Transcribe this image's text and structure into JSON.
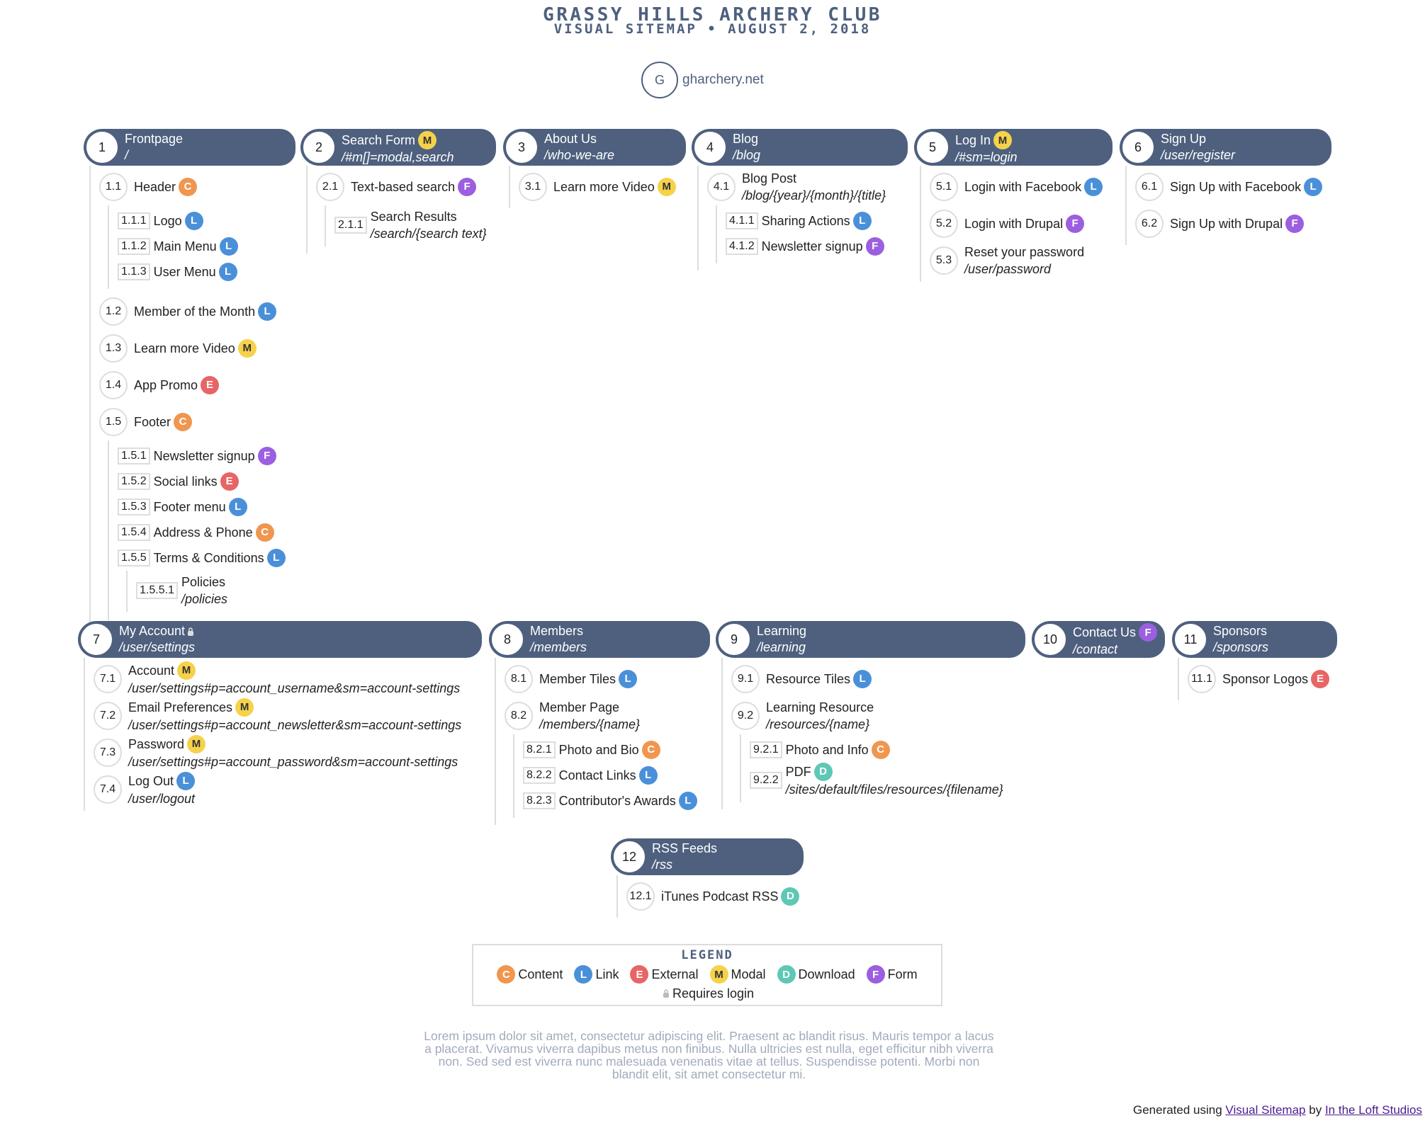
{
  "header": {
    "title": "GRASSY HILLS ARCHERY CLUB",
    "subtitle": "VISUAL SITEMAP • AUGUST 2, 2018"
  },
  "home": {
    "letter": "G",
    "label": "gharchery.net"
  },
  "colors": {
    "header_bg": "#4e607e",
    "C": "#f0964f",
    "L": "#4a90d9",
    "E": "#e86565",
    "M": "#f5d24a",
    "D": "#5ec8b5",
    "F": "#9b5fe0"
  },
  "sections": [
    {
      "num": "1",
      "title": "Frontpage",
      "path": "/",
      "items": [
        {
          "num": "1.1",
          "label": "Header",
          "badge": "C",
          "children": [
            {
              "num": "1.1.1",
              "label": "Logo",
              "badge": "L"
            },
            {
              "num": "1.1.2",
              "label": "Main Menu",
              "badge": "L"
            },
            {
              "num": "1.1.3",
              "label": "User Menu",
              "badge": "L"
            }
          ]
        },
        {
          "num": "1.2",
          "label": "Member of the Month",
          "badge": "L"
        },
        {
          "num": "1.3",
          "label": "Learn more Video",
          "badge": "M"
        },
        {
          "num": "1.4",
          "label": "App Promo",
          "badge": "E"
        },
        {
          "num": "1.5",
          "label": "Footer",
          "badge": "C",
          "children": [
            {
              "num": "1.5.1",
              "label": "Newsletter signup",
              "badge": "F"
            },
            {
              "num": "1.5.2",
              "label": "Social links",
              "badge": "E"
            },
            {
              "num": "1.5.3",
              "label": "Footer menu",
              "badge": "L"
            },
            {
              "num": "1.5.4",
              "label": "Address & Phone",
              "badge": "C"
            },
            {
              "num": "1.5.5",
              "label": "Terms & Conditions",
              "badge": "L",
              "children": [
                {
                  "num": "1.5.5.1",
                  "label": "Policies",
                  "path": "/policies"
                }
              ]
            }
          ]
        }
      ]
    },
    {
      "num": "2",
      "title": "Search Form",
      "badge": "M",
      "path": "/#m[]=modal,search",
      "items": [
        {
          "num": "2.1",
          "label": "Text-based search",
          "badge": "F",
          "children": [
            {
              "num": "2.1.1",
              "label": "Search Results",
              "path": "/search/{search text}"
            }
          ]
        }
      ]
    },
    {
      "num": "3",
      "title": "About Us",
      "path": "/who-we-are",
      "items": [
        {
          "num": "3.1",
          "label": "Learn more Video",
          "badge": "M"
        }
      ]
    },
    {
      "num": "4",
      "title": "Blog",
      "path": "/blog",
      "items": [
        {
          "num": "4.1",
          "label": "Blog Post",
          "path": "/blog/{year}/{month}/{title}",
          "children": [
            {
              "num": "4.1.1",
              "label": "Sharing Actions",
              "badge": "L"
            },
            {
              "num": "4.1.2",
              "label": "Newsletter signup",
              "badge": "F"
            }
          ]
        }
      ]
    },
    {
      "num": "5",
      "title": "Log In",
      "badge": "M",
      "path": "/#sm=login",
      "items": [
        {
          "num": "5.1",
          "label": "Login with Facebook",
          "badge": "L"
        },
        {
          "num": "5.2",
          "label": "Login with Drupal",
          "badge": "F"
        },
        {
          "num": "5.3",
          "label": "Reset your password",
          "path": "/user/password"
        }
      ]
    },
    {
      "num": "6",
      "title": "Sign Up",
      "path": "/user/register",
      "items": [
        {
          "num": "6.1",
          "label": "Sign Up with Facebook",
          "badge": "L"
        },
        {
          "num": "6.2",
          "label": "Sign Up with Drupal",
          "badge": "F"
        }
      ]
    },
    {
      "num": "7",
      "title": "My Account",
      "requires_login": true,
      "path": "/user/settings",
      "items": [
        {
          "num": "7.1",
          "label": "Account",
          "badge": "M",
          "path": "/user/settings#p=account_username&sm=account-settings"
        },
        {
          "num": "7.2",
          "label": "Email Preferences",
          "badge": "M",
          "path": "/user/settings#p=account_newsletter&sm=account-settings"
        },
        {
          "num": "7.3",
          "label": "Password",
          "badge": "M",
          "path": "/user/settings#p=account_password&sm=account-settings"
        },
        {
          "num": "7.4",
          "label": "Log Out",
          "badge": "L",
          "path": "/user/logout"
        }
      ]
    },
    {
      "num": "8",
      "title": "Members",
      "path": "/members",
      "items": [
        {
          "num": "8.1",
          "label": "Member Tiles",
          "badge": "L"
        },
        {
          "num": "8.2",
          "label": "Member Page",
          "path": "/members/{name}",
          "children": [
            {
              "num": "8.2.1",
              "label": "Photo and Bio",
              "badge": "C"
            },
            {
              "num": "8.2.2",
              "label": "Contact Links",
              "badge": "L"
            },
            {
              "num": "8.2.3",
              "label": "Contributor's Awards",
              "badge": "L"
            }
          ]
        }
      ]
    },
    {
      "num": "9",
      "title": "Learning",
      "path": "/learning",
      "items": [
        {
          "num": "9.1",
          "label": "Resource Tiles",
          "badge": "L"
        },
        {
          "num": "9.2",
          "label": "Learning Resource",
          "path": "/resources/{name}",
          "children": [
            {
              "num": "9.2.1",
              "label": "Photo and Info",
              "badge": "C"
            },
            {
              "num": "9.2.2",
              "label": "PDF",
              "badge": "D",
              "path": "/sites/default/files/resources/{filename}"
            }
          ]
        }
      ]
    },
    {
      "num": "10",
      "title": "Contact Us",
      "badge": "F",
      "path": "/contact",
      "items": []
    },
    {
      "num": "11",
      "title": "Sponsors",
      "path": "/sponsors",
      "items": [
        {
          "num": "11.1",
          "label": "Sponsor Logos",
          "badge": "E"
        }
      ]
    },
    {
      "num": "12",
      "title": "RSS Feeds",
      "path": "/rss",
      "items": [
        {
          "num": "12.1",
          "label": "iTunes Podcast RSS",
          "badge": "D"
        }
      ]
    }
  ],
  "legend": {
    "title": "LEGEND",
    "entries": [
      {
        "key": "C",
        "label": "Content"
      },
      {
        "key": "L",
        "label": "Link"
      },
      {
        "key": "E",
        "label": "External"
      },
      {
        "key": "M",
        "label": "Modal"
      },
      {
        "key": "D",
        "label": "Download"
      },
      {
        "key": "F",
        "label": "Form"
      }
    ],
    "requires_login": "Requires login"
  },
  "description": "Lorem ipsum dolor sit amet, consectetur adipiscing elit. Praesent ac blandit risus. Mauris tempor a lacus a placerat. Vivamus viverra dapibus metus non finibus. Nulla ultricies est nulla, eget efficitur nibh viverra non. Sed sed est viverra nunc malesuada venenatis vitae at tellus. Suspendisse potenti. Morbi non blandit elit, sit amet consectetur mi.",
  "footer": {
    "prefix": "Generated using",
    "link1": "Visual Sitemap",
    "middle": "by",
    "link2": "In the Loft Studios"
  }
}
